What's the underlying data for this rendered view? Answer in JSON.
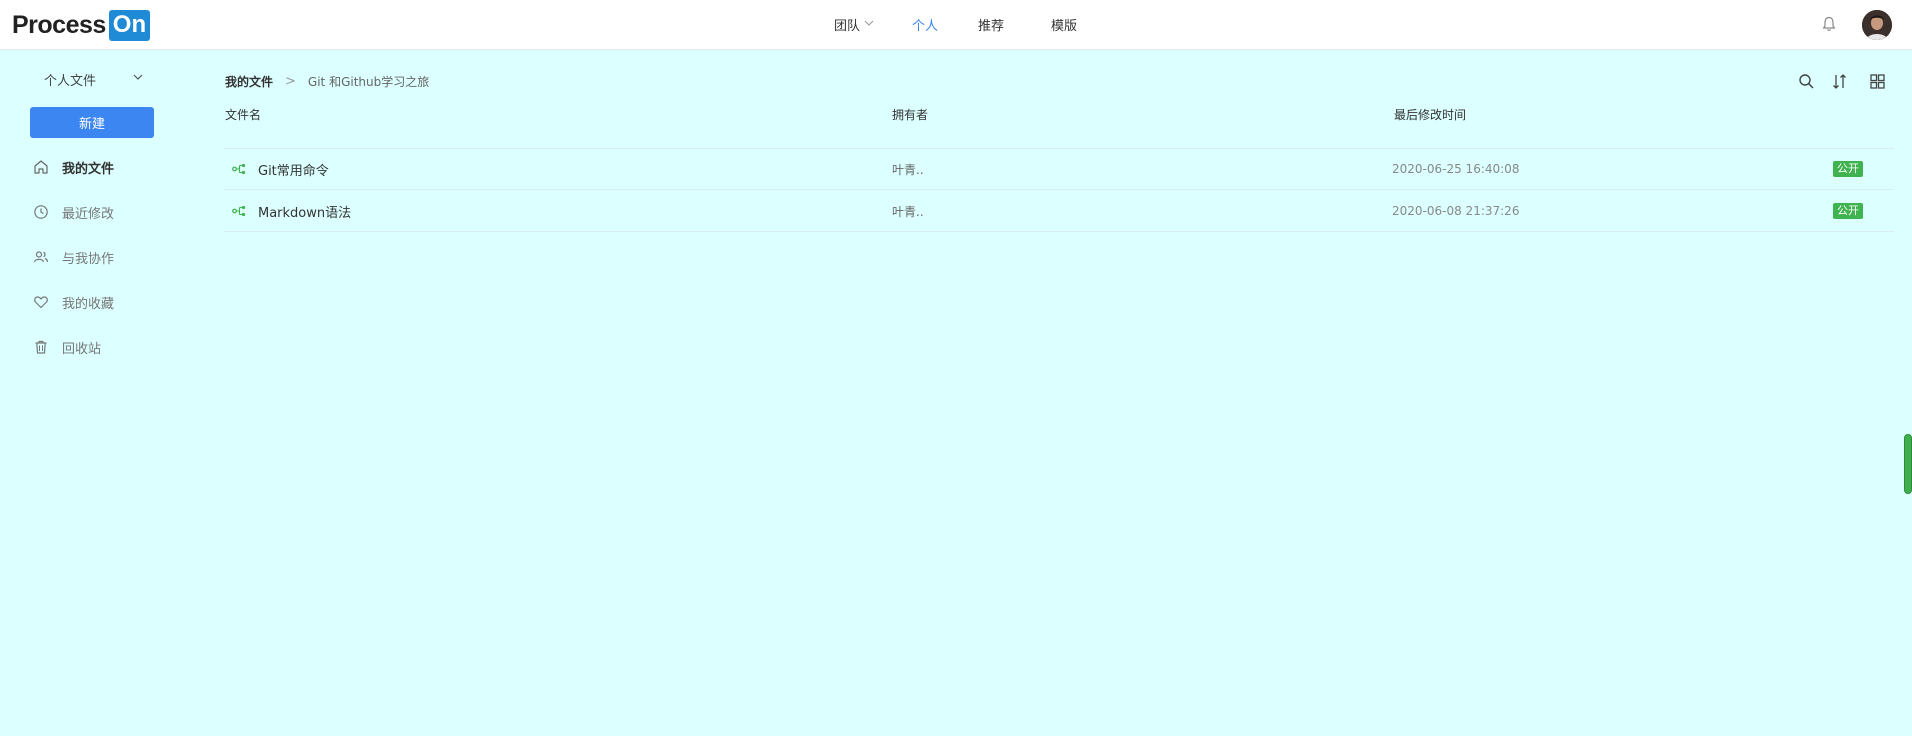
{
  "header": {
    "logo_text_a": "Process",
    "logo_text_b": "On",
    "nav": [
      {
        "label": "团队",
        "has_dropdown": true
      },
      {
        "label": "个人",
        "active": true
      },
      {
        "label": "推荐"
      },
      {
        "label": "模版"
      }
    ]
  },
  "sidebar": {
    "doc_switch_label": "个人文件",
    "new_button_label": "新建",
    "items": [
      {
        "label": "我的文件",
        "icon": "home-icon",
        "active": true
      },
      {
        "label": "最近修改",
        "icon": "clock-icon"
      },
      {
        "label": "与我协作",
        "icon": "users-icon"
      },
      {
        "label": "我的收藏",
        "icon": "heart-icon"
      },
      {
        "label": "回收站",
        "icon": "trash-icon"
      }
    ]
  },
  "main": {
    "breadcrumb": {
      "root": "我的文件",
      "separator": ">",
      "current": "Git 和Github学习之旅"
    },
    "columns": {
      "name": "文件名",
      "owner": "拥有者",
      "modified": "最后修改时间"
    },
    "files": [
      {
        "name": "Git常用命令",
        "owner": "叶青..",
        "modified": "2020-06-25 16:40:08",
        "visibility": "公开"
      },
      {
        "name": "Markdown语法",
        "owner": "叶青..",
        "modified": "2020-06-08 21:37:26",
        "visibility": "公开"
      }
    ]
  },
  "colors": {
    "accent": "#3b86f0",
    "background": "#dcffff",
    "public_badge": "#3fb34f",
    "file_icon": "#3fb34f"
  }
}
